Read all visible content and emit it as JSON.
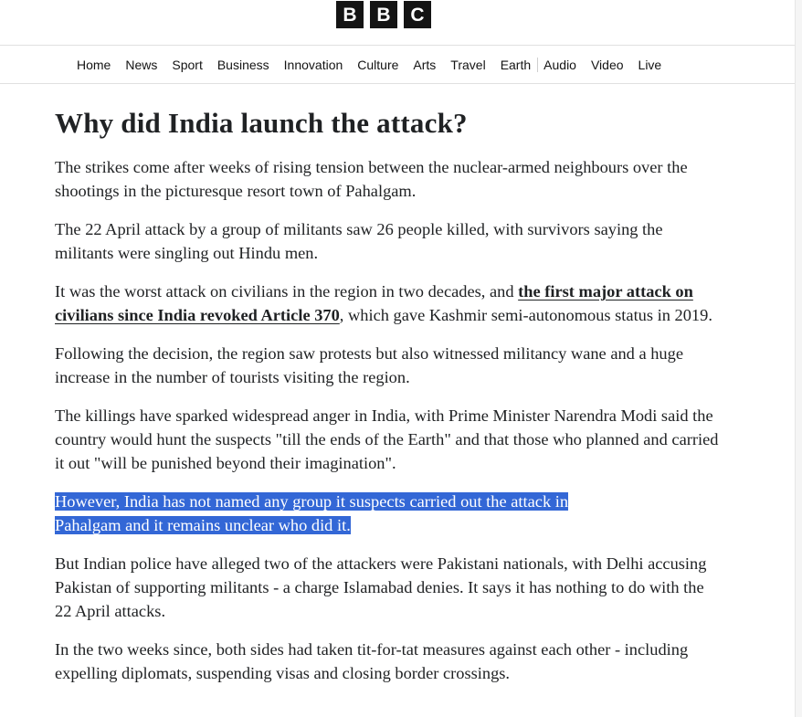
{
  "logo": {
    "letters": [
      "B",
      "B",
      "C"
    ]
  },
  "nav": {
    "items": [
      "Home",
      "News",
      "Sport",
      "Business",
      "Innovation",
      "Culture",
      "Arts",
      "Travel",
      "Earth",
      "Audio",
      "Video",
      "Live"
    ]
  },
  "article": {
    "heading": "Why did India launch the attack?",
    "p1": "The strikes come after weeks of rising tension between the nuclear-armed neighbours over the shootings in the picturesque resort town of Pahalgam.",
    "p2": "The 22 April attack by a group of militants saw 26 people killed, with survivors saying the militants were singling out Hindu men.",
    "p3_before": "It was the worst attack on civilians in the region in two decades, and ",
    "p3_link": "the first major attack on civilians since India revoked Article 370",
    "p3_after": ", which gave Kashmir semi-autonomous status in 2019.",
    "p4": "Following the decision, the region saw protests but also witnessed militancy wane and a huge increase in the number of tourists visiting the region.",
    "p5": "The killings have sparked widespread anger in India, with Prime Minister Narendra Modi said the country would hunt the suspects \"till the ends of the Earth\" and that those who planned and carried it out \"will be punished beyond their imagination\".",
    "p6_line1": "However, India has not named any group it suspects carried out the attack in",
    "p6_line2": "Pahalgam and it remains unclear who did it.",
    "p7": "But Indian police have alleged two of the attackers were Pakistani nationals, with Delhi accusing Pakistan of supporting militants - a charge Islamabad denies. It says it has nothing to do with the 22 April attacks.",
    "p8": "In the two weeks since, both sides had taken tit-for-tat measures against each other - including expelling diplomats, suspending visas and closing border crossings."
  },
  "colors": {
    "selection": "#3367d6",
    "text": "#202224"
  }
}
